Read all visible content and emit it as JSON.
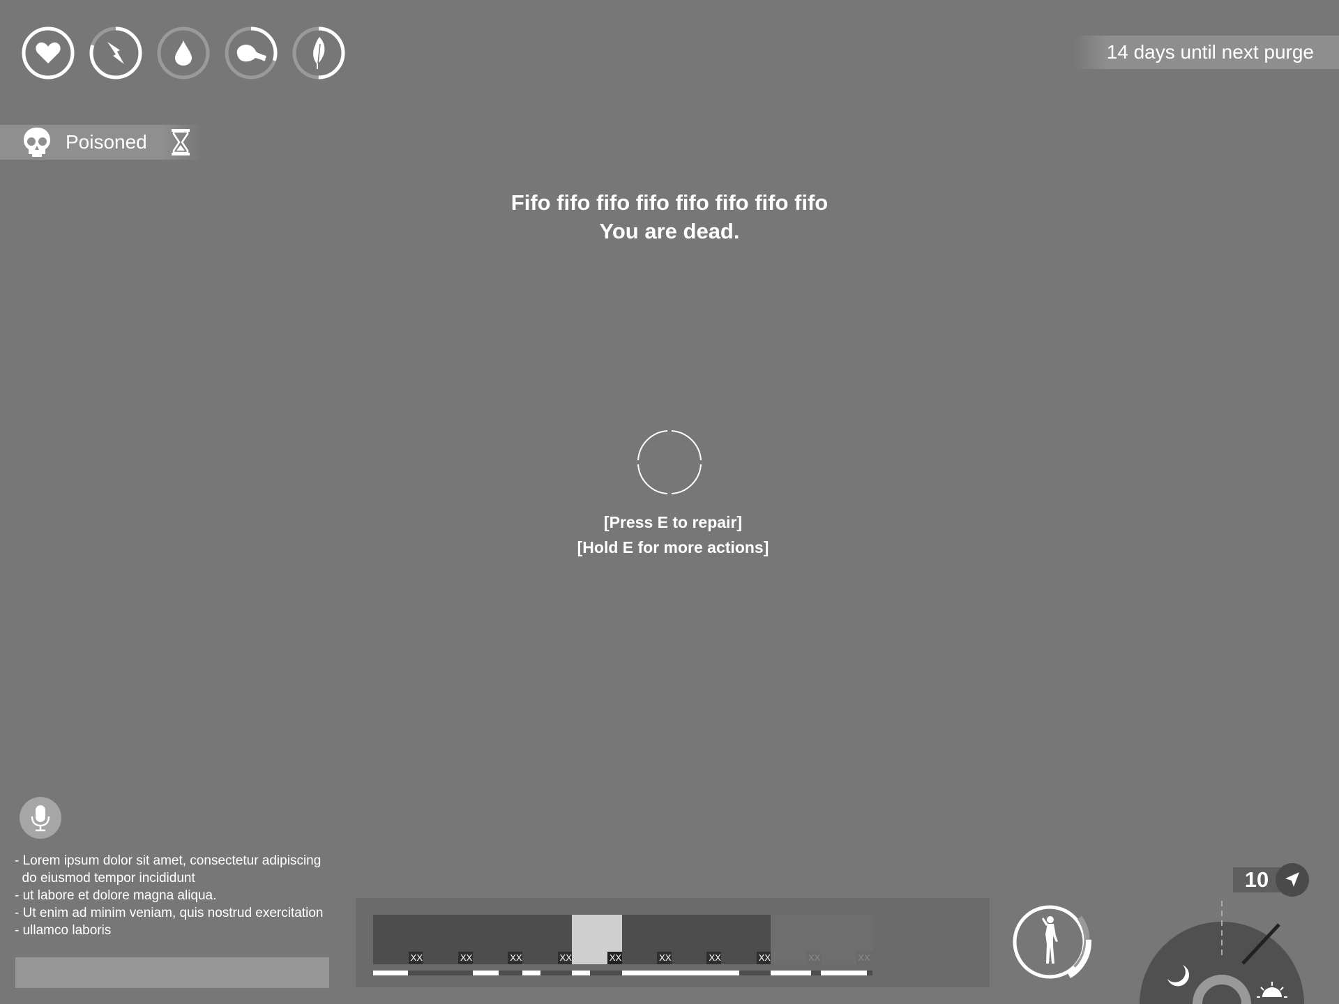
{
  "stats": [
    {
      "name": "health",
      "icon": "heart-icon",
      "level": 1.0
    },
    {
      "name": "energy",
      "icon": "lightning-icon",
      "level": 0.8
    },
    {
      "name": "thirst",
      "icon": "water-drop-icon",
      "level": 0.0
    },
    {
      "name": "hunger",
      "icon": "drumstick-icon",
      "level": 0.3
    },
    {
      "name": "temperature",
      "icon": "feather-icon",
      "level": 0.5
    }
  ],
  "purge_text": "14 days until next purge",
  "status_effect": {
    "label": "Poisoned",
    "icon": "skull-icon",
    "timer_icon": "hourglass-icon"
  },
  "message": {
    "line1": "Fifo fifo fifo fifo fifo fifo fifo fifo",
    "line2": "You are dead."
  },
  "prompts": {
    "line1": "[Press E to repair]",
    "line2": "[Hold E for more actions]"
  },
  "chat_log": [
    "- Lorem ipsum dolor sit amet, consectetur adipiscing",
    "  do eiusmod tempor incididunt",
    "- ut labore et dolore magna aliqua.",
    "- Ut enim ad minim veniam, quis nostrud exercitation",
    "- ullamco laboris"
  ],
  "hotbar": [
    {
      "qty": "XX",
      "durability": 0.68,
      "state": "filled"
    },
    {
      "qty": "XX",
      "durability": 0.0,
      "state": "filled"
    },
    {
      "qty": "XX",
      "durability": 0.5,
      "state": "filled"
    },
    {
      "qty": "XX",
      "durability": 0.35,
      "state": "filled"
    },
    {
      "qty": "XX",
      "durability": 0.35,
      "state": "selected"
    },
    {
      "qty": "XX",
      "durability": 1.0,
      "state": "filled"
    },
    {
      "qty": "XX",
      "durability": 1.0,
      "state": "filled"
    },
    {
      "qty": "XX",
      "durability": 0.35,
      "state": "filled"
    },
    {
      "qty": "XX",
      "durability": 0.78,
      "state": "empty"
    },
    {
      "qty": "XX",
      "durability": 0.9,
      "state": "empty"
    }
  ],
  "stance_icon": "standing-figure-icon",
  "stance_level": 0.55,
  "compass_value": "10",
  "nav_icon": "navigation-arrow-icon",
  "time_icons": {
    "night": "moon-icon",
    "day": "sun-icon"
  }
}
